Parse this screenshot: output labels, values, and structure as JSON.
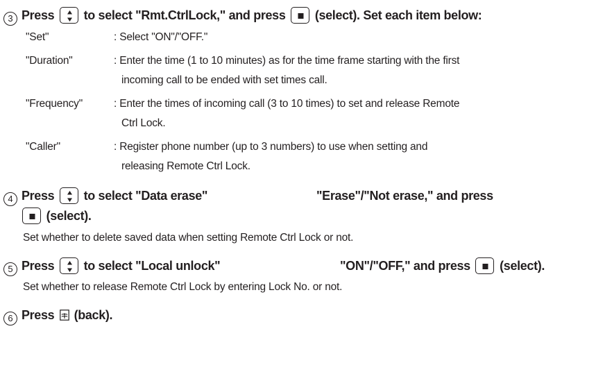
{
  "step3": {
    "number": "3",
    "press": "Press",
    "text_mid": "to select \"Rmt.CtrlLock,\" and press",
    "text_end": "(select). Set each item below:"
  },
  "items": [
    {
      "term": "\"Set\"",
      "desc": [
        ": Select \"ON\"/\"OFF.\""
      ]
    },
    {
      "term": "\"Duration\"",
      "desc": [
        ": Enter the time (1 to 10 minutes) as for the time frame starting with the first",
        "incoming call to be ended with set times call."
      ]
    },
    {
      "term": "\"Frequency\"",
      "desc": [
        ": Enter the times of incoming call (3 to 10 times) to set and release Remote",
        "Ctrl Lock."
      ]
    },
    {
      "term": "\"Caller\"",
      "desc": [
        ": Register phone number (up to 3 numbers) to use when setting and",
        "releasing Remote Ctrl Lock."
      ]
    }
  ],
  "step4": {
    "number": "4",
    "press": "Press",
    "text_mid": "to select \"Data erase\"",
    "text_choice": "\"Erase\"/\"Not erase,\" and press",
    "text_line2": "(select).",
    "note": "Set whether to delete saved data when setting Remote Ctrl Lock or not."
  },
  "step5": {
    "number": "5",
    "press": "Press",
    "text_mid": "to select \"Local unlock\"",
    "text_choice": "\"ON\"/\"OFF,\" and press",
    "text_end": "(select).",
    "note": "Set whether to release Remote Ctrl Lock by entering Lock No. or not."
  },
  "step6": {
    "number": "6",
    "press": "Press",
    "text_end": "(back)."
  }
}
